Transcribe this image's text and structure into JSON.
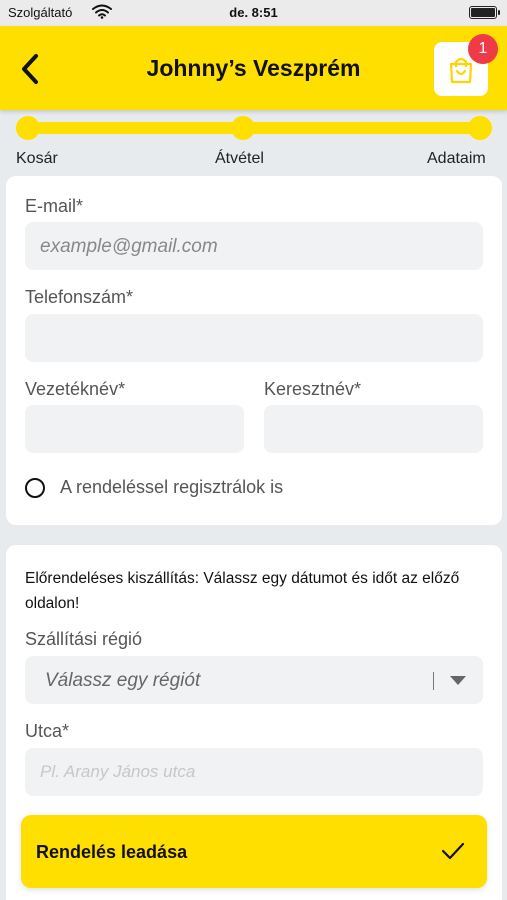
{
  "status_bar": {
    "carrier": "Szolgáltató",
    "time": "de. 8:51"
  },
  "header": {
    "title": "Johnny’s Veszprém",
    "cart_count": "1"
  },
  "stepper": {
    "steps": [
      "Kosár",
      "Átvétel",
      "Adataim"
    ]
  },
  "form": {
    "email_label": "E-mail*",
    "email_placeholder": "example@gmail.com",
    "phone_label": "Telefonszám*",
    "phone_value": "",
    "lastname_label": "Vezetéknév*",
    "firstname_label": "Keresztnév*",
    "register_label": "A rendeléssel regisztrálok is"
  },
  "delivery": {
    "notice": "Előrendeléses kiszállítás: Válassz egy dátumot és időt az előző oldalon!",
    "region_label": "Szállítási régió",
    "region_placeholder": "Válassz egy régiót",
    "street_label": "Utca*",
    "street_placeholder": "Pl. Arany János utca"
  },
  "submit": {
    "label": "Rendelés leadása"
  },
  "colors": {
    "brand": "#ffdf00",
    "badge": "#ef3b46"
  }
}
